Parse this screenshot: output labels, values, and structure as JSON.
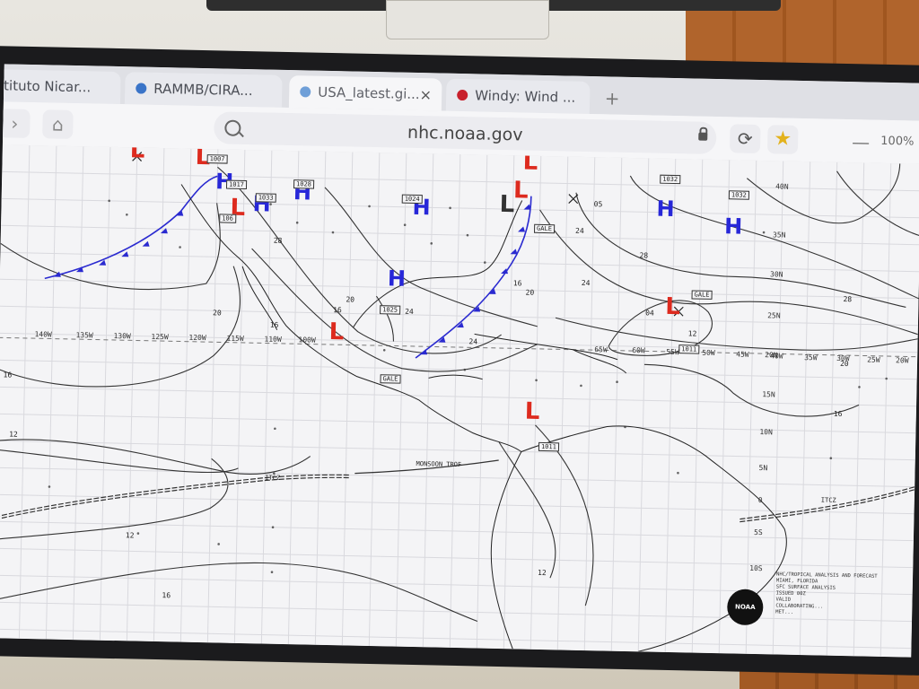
{
  "browser": {
    "tabs": [
      {
        "title": "stituto Nicar...",
        "favicon": "#cfcfcf",
        "active": false
      },
      {
        "title": "RAMMB/CIRA...",
        "favicon": "#3a74c8",
        "active": false
      },
      {
        "title": "USA_latest.gi...",
        "favicon": "#6f9fd8",
        "active": true
      },
      {
        "title": "Windy: Wind ...",
        "favicon": "#c8202c",
        "active": false
      }
    ],
    "close_glyph": "×",
    "newtab_glyph": "+",
    "url": "nhc.noaa.gov",
    "zoom": "100%",
    "zoom_minus": "—",
    "reload_glyph": "⟳",
    "star_glyph": "★",
    "back_glyph": "›",
    "home_glyph": "⌂"
  },
  "map": {
    "pressure_centers": [
      {
        "type": "H",
        "label": "H"
      },
      {
        "type": "L",
        "label": "L"
      }
    ],
    "boxed_labels": [
      "1007",
      "1017",
      "1033",
      "1028",
      "1024",
      "1025",
      "106",
      "1032",
      "1032",
      "1011",
      "1011",
      "GALE",
      "GALE",
      "GALE"
    ],
    "longitudes": [
      "140W",
      "135W",
      "130W",
      "125W",
      "120W",
      "115W",
      "110W",
      "100W",
      "65W",
      "60W",
      "55W",
      "50W",
      "45W",
      "40W",
      "35W",
      "30W",
      "25W",
      "20W"
    ],
    "latitudes": [
      "40N",
      "35N",
      "30N",
      "25N",
      "20N",
      "15N",
      "10N",
      "5N",
      "0",
      "5S",
      "10S"
    ],
    "isobar_values": [
      "20",
      "16",
      "12",
      "16",
      "20",
      "24",
      "28",
      "24",
      "20",
      "16",
      "12",
      "16",
      "24",
      "28",
      "12",
      "04",
      "16",
      "12",
      "20",
      "16",
      "28",
      "05",
      "24"
    ],
    "annotations": {
      "itcz_west": "ITCZ",
      "monsoon": "MONSOON TROF",
      "itcz_east": "ITCZ"
    },
    "logo_text": "NOAA",
    "credit_lines": [
      "NHC/TROPICAL ANALYSIS AND FORECAST",
      "MIAMI, FLORIDA",
      "SFC SURFACE ANALYSIS",
      "ISSUED 00Z",
      "VALID",
      "COLLABORATING...",
      "MET..."
    ]
  },
  "colors": {
    "high": "#2727d8",
    "low": "#dd2a1e",
    "front": "#2a2ad0"
  }
}
